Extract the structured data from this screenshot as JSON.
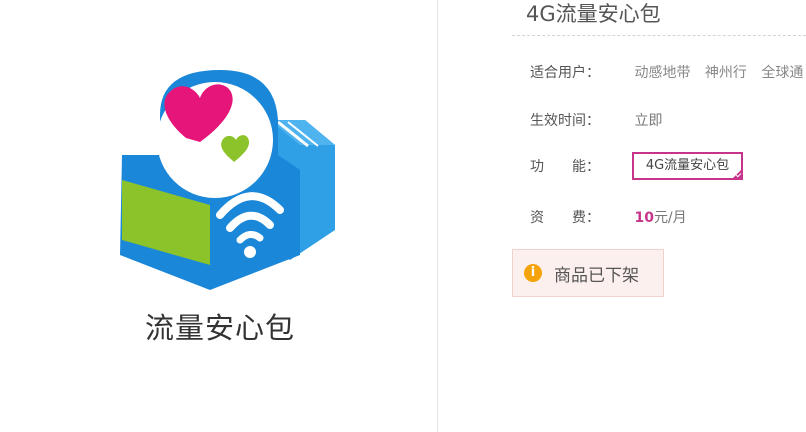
{
  "product": {
    "caption": "流量安心包",
    "title": "4G流量安心包"
  },
  "details": {
    "users_label": "适合用户：",
    "users": [
      "动感地带",
      "神州行",
      "全球通"
    ],
    "effective_label": "生效时间：",
    "effective_value": "立即",
    "feature_label": "功　　能：",
    "feature_value": "4G流量安心包",
    "price_label": "资　　费：",
    "price_number": "10",
    "price_unit": "元/月"
  },
  "notice": {
    "icon": "info-icon",
    "text": "商品已下架"
  },
  "colors": {
    "accent": "#c7358b",
    "notice_bg": "#fcf0ee",
    "notice_icon": "#f5a30a",
    "box_blue": "#1a87d8",
    "box_green": "#8cc22a",
    "heart_pink": "#e5157a"
  }
}
